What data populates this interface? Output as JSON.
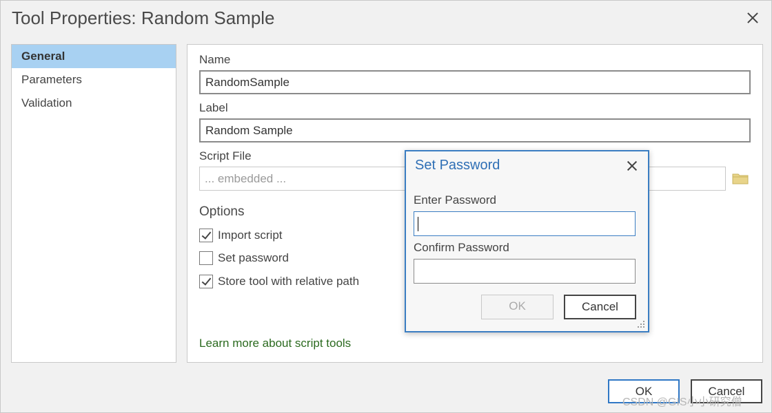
{
  "window": {
    "title": "Tool Properties: Random Sample"
  },
  "nav": {
    "items": [
      {
        "label": "General"
      },
      {
        "label": "Parameters"
      },
      {
        "label": "Validation"
      }
    ]
  },
  "general": {
    "name_label": "Name",
    "name_value": "RandomSample",
    "label_label": "Label",
    "label_value": "Random Sample",
    "script_file_label": "Script File",
    "script_file_placeholder": "... embedded ...",
    "options_heading": "Options",
    "options": [
      {
        "label": "Import script",
        "checked": true
      },
      {
        "label": "Set password",
        "checked": false
      },
      {
        "label": "Store tool with relative path",
        "checked": true
      }
    ],
    "learn_more_link": "Learn more about script tools"
  },
  "footer": {
    "ok_label": "OK",
    "cancel_label": "Cancel"
  },
  "password_dialog": {
    "title": "Set Password",
    "enter_label": "Enter Password",
    "confirm_label": "Confirm Password",
    "ok_label": "OK",
    "cancel_label": "Cancel"
  },
  "watermark": "CSDN @GIS小小研究僧",
  "colors": {
    "nav_selected": "#a8d1f2",
    "dialog_accent": "#3a7dc2",
    "link": "#2b6a1f",
    "folder_icon": "#e8d48a"
  },
  "icons": [
    "close-icon",
    "folder-icon",
    "check-icon",
    "resize-grip-icon"
  ]
}
